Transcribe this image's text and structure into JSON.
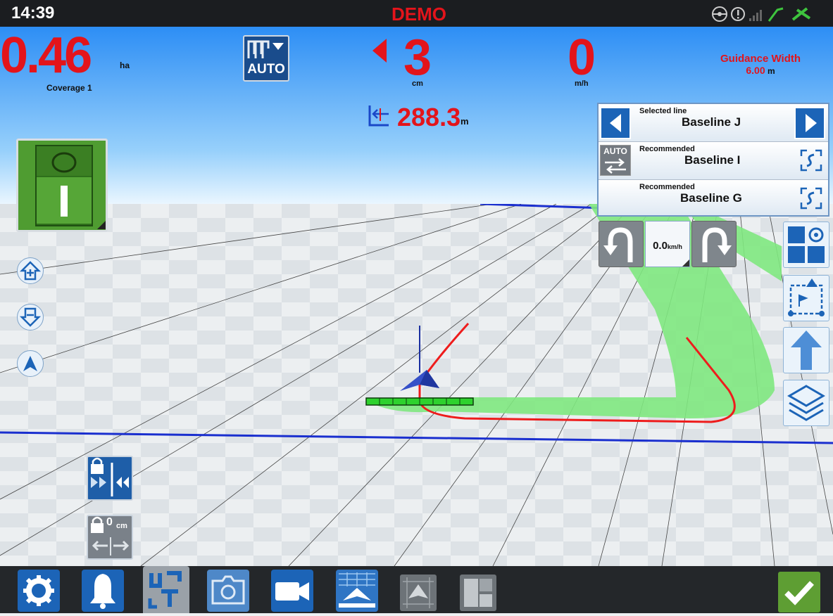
{
  "status_bar": {
    "time": "14:39",
    "mode": "DEMO"
  },
  "coverage": {
    "value": ".46",
    "value_lead": "0",
    "unit": "ha",
    "label": "Coverage 1"
  },
  "auto_button": {
    "label": "AUTO"
  },
  "cross_track": {
    "value": "3",
    "unit": "cm"
  },
  "speed": {
    "value": "0",
    "unit": "m/h"
  },
  "guidance": {
    "label": "Guidance Width",
    "value": "6.00",
    "unit": "m"
  },
  "distance": {
    "value": "288.3",
    "unit": "m"
  },
  "line_panel": {
    "selected_caption": "Selected line",
    "selected_name": "Baseline J",
    "auto_label": "AUTO",
    "rec1_caption": "Recommended",
    "rec1_name": "Baseline I",
    "rec2_caption": "Recommended",
    "rec2_name": "Baseline G"
  },
  "turn_speed": {
    "value": "0.0",
    "unit": "km/h"
  },
  "offset": {
    "value": "0",
    "unit": "cm"
  },
  "colors": {
    "accent_red": "#e3141b",
    "ui_blue": "#1c64b7",
    "confirm_green": "#5e9e33",
    "coverage_green": "#7fe87f"
  },
  "icons": [
    "steering-wheel-icon",
    "warning-icon",
    "signal-bars-icon",
    "gps-antenna-icon",
    "settings-gear-icon",
    "alarm-bell-icon",
    "ut-icon",
    "camera-icon",
    "video-icon",
    "guidance-view-icon",
    "field-view-icon",
    "layout-icon",
    "checkmark-icon"
  ]
}
